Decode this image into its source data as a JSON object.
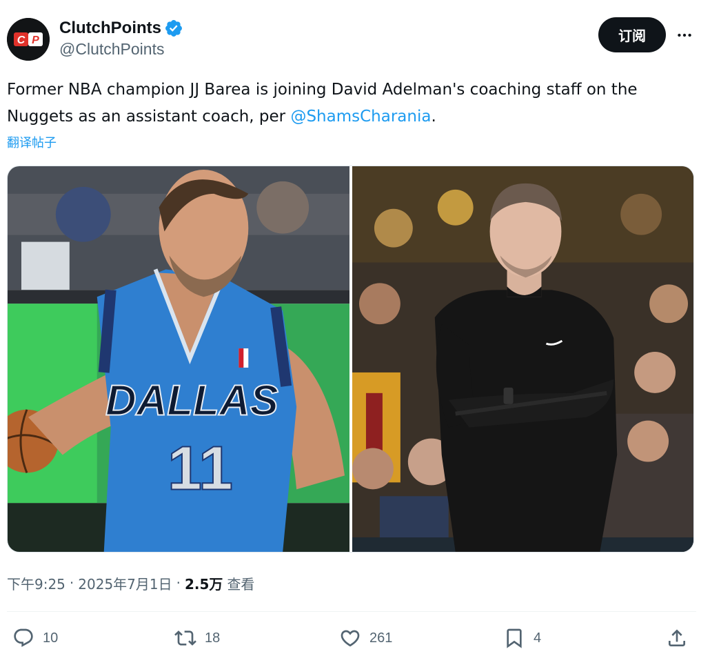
{
  "author": {
    "display_name": "ClutchPoints",
    "handle": "@ClutchPoints",
    "avatar_text": "CP",
    "verified": true
  },
  "header": {
    "subscribe_label": "订阅",
    "more_icon": "more-dots-icon"
  },
  "tweet": {
    "text_before": "Former NBA champion JJ Barea is joining David Adelman's coaching staff on the Nuggets as an assistant coach, per ",
    "mention": "@ShamsCharania",
    "text_after": ".",
    "translate_label": "翻译帖子"
  },
  "media": {
    "left_jersey_team": "DALLAS",
    "left_jersey_number": "11"
  },
  "meta": {
    "time": "下午9:25",
    "separator": "·",
    "date": "2025年7月1日",
    "views_count": "2.5万",
    "views_label": "查看"
  },
  "actions": {
    "reply_count": "10",
    "retweet_count": "18",
    "like_count": "261",
    "bookmark_count": "4"
  },
  "colors": {
    "accent": "#1d9bf0",
    "text_primary": "#0f1419",
    "text_secondary": "#536471",
    "button_dark": "#0f1419",
    "jersey_blue": "#2f7fd0"
  }
}
